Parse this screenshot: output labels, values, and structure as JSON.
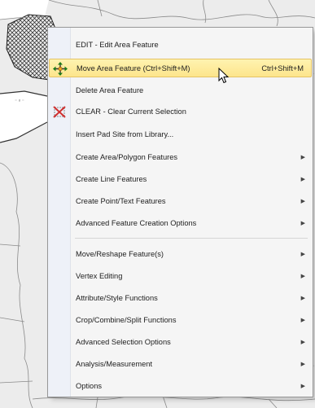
{
  "menu": {
    "items": [
      {
        "label": "EDIT - Edit Area Feature",
        "icon": "",
        "submenu": false
      },
      {
        "label": "Move Area Feature (Ctrl+Shift+M)",
        "shortcut": "Ctrl+Shift+M",
        "icon": "move-icon",
        "submenu": false,
        "highlighted": true
      },
      {
        "label": "Delete Area Feature",
        "icon": "",
        "submenu": false
      },
      {
        "label": "CLEAR - Clear Current Selection",
        "icon": "clear-selection-icon",
        "submenu": false
      },
      {
        "label": "Insert Pad Site from Library...",
        "icon": "",
        "submenu": false
      },
      {
        "label": "Create Area/Polygon Features",
        "icon": "",
        "submenu": true
      },
      {
        "label": "Create Line Features",
        "icon": "",
        "submenu": true
      },
      {
        "label": "Create Point/Text Features",
        "icon": "",
        "submenu": true
      },
      {
        "label": "Advanced Feature Creation Options",
        "icon": "",
        "submenu": true
      },
      {
        "label": "Move/Reshape Feature(s)",
        "icon": "",
        "submenu": true
      },
      {
        "label": "Vertex Editing",
        "icon": "",
        "submenu": true
      },
      {
        "label": "Attribute/Style Functions",
        "icon": "",
        "submenu": true
      },
      {
        "label": "Crop/Combine/Split Functions",
        "icon": "",
        "submenu": true
      },
      {
        "label": "Advanced Selection Options",
        "icon": "",
        "submenu": true
      },
      {
        "label": "Analysis/Measurement",
        "icon": "",
        "submenu": true
      },
      {
        "label": "Options",
        "icon": "",
        "submenu": true
      }
    ]
  },
  "colors": {
    "highlight": "#fde58c",
    "gutter": "#eef1f8",
    "map_land": "#ececec",
    "map_border": "#555555"
  }
}
